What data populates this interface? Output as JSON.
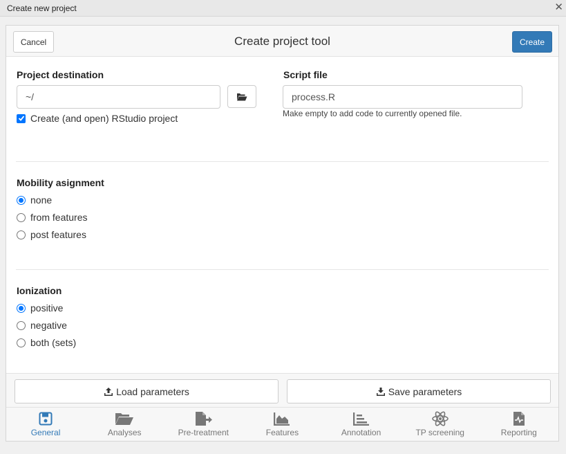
{
  "window": {
    "title": "Create new project",
    "close_glyph": "✕"
  },
  "header": {
    "cancel_label": "Cancel",
    "title": "Create project tool",
    "create_label": "Create"
  },
  "project_destination": {
    "label": "Project destination",
    "value": "~/",
    "browse_icon": "folder-open-icon",
    "checkbox_label": "Create (and open) RStudio project",
    "checkbox_checked": true
  },
  "script_file": {
    "label": "Script file",
    "value": "process.R",
    "help": "Make empty to add code to currently opened file."
  },
  "mobility": {
    "label": "Mobility asignment",
    "options": [
      {
        "label": "none",
        "selected": true
      },
      {
        "label": "from features",
        "selected": false
      },
      {
        "label": "post features",
        "selected": false
      }
    ]
  },
  "ionization": {
    "label": "Ionization",
    "options": [
      {
        "label": "positive",
        "selected": true
      },
      {
        "label": "negative",
        "selected": false
      },
      {
        "label": "both (sets)",
        "selected": false
      }
    ]
  },
  "footer": {
    "load_label": "Load parameters",
    "save_label": "Save parameters"
  },
  "tabs": [
    {
      "label": "General",
      "icon": "save-icon",
      "active": true
    },
    {
      "label": "Analyses",
      "icon": "folder-open-icon",
      "active": false
    },
    {
      "label": "Pre-treatment",
      "icon": "file-export-icon",
      "active": false
    },
    {
      "label": "Features",
      "icon": "area-chart-icon",
      "active": false
    },
    {
      "label": "Annotation",
      "icon": "bar-list-icon",
      "active": false
    },
    {
      "label": "TP screening",
      "icon": "atom-icon",
      "active": false
    },
    {
      "label": "Reporting",
      "icon": "file-waveform-icon",
      "active": false
    }
  ],
  "colors": {
    "primary": "#337ab7",
    "accent": "#0075ff",
    "tab_inactive": "#777777"
  }
}
